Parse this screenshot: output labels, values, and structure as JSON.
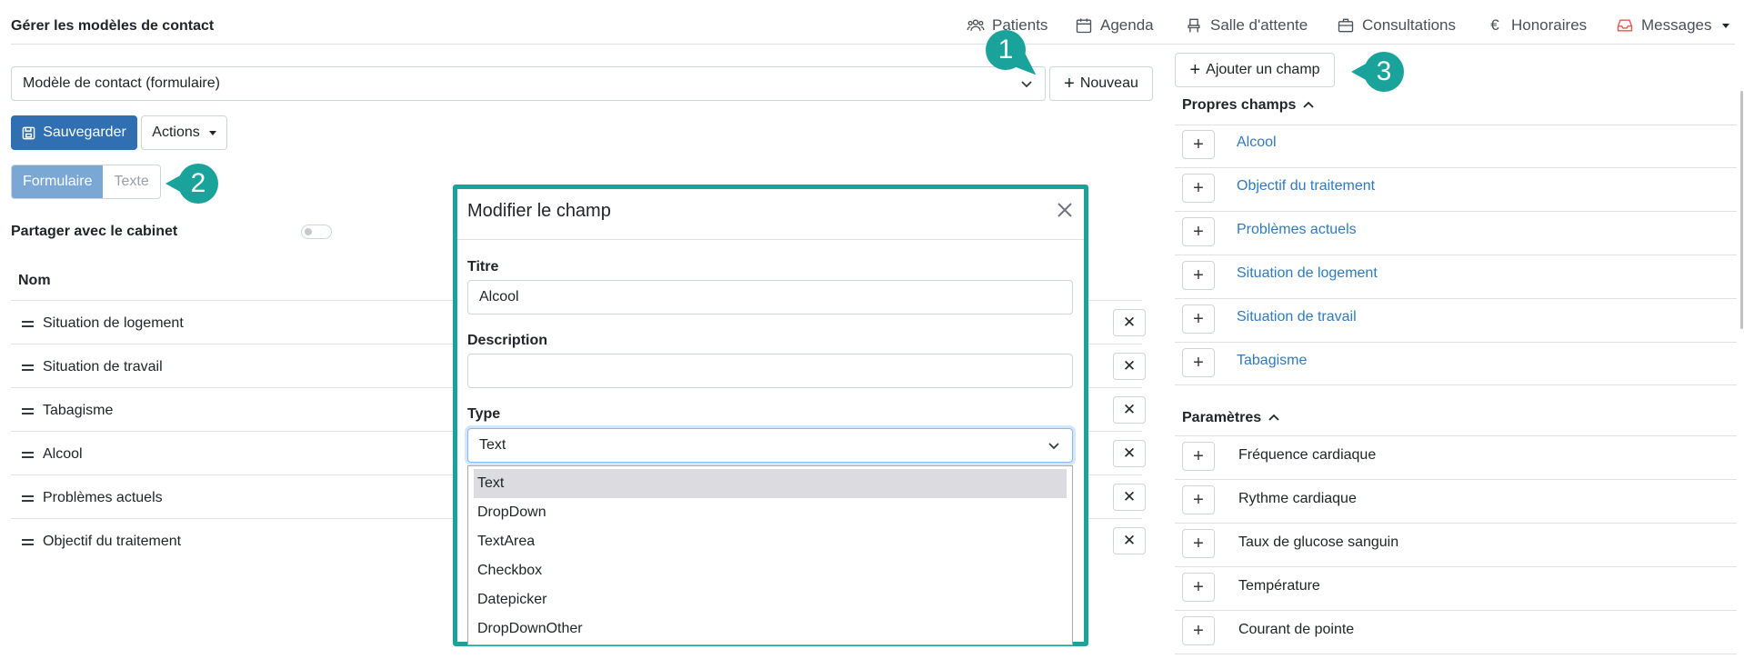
{
  "header": {
    "title": "Gérer les modèles de contact",
    "nav": [
      {
        "label": "Patients",
        "icon": "users-icon"
      },
      {
        "label": "Agenda",
        "icon": "calendar-icon"
      },
      {
        "label": "Salle d'attente",
        "icon": "chair-icon"
      },
      {
        "label": "Consultations",
        "icon": "briefcase-icon"
      },
      {
        "label": "Honoraires",
        "icon": "euro-icon"
      },
      {
        "label": "Messages",
        "icon": "inbox-icon"
      }
    ]
  },
  "template": {
    "selected": "Modèle de contact (formulaire)",
    "new_label": "Nouveau"
  },
  "toolbar": {
    "save_label": "Sauvegarder",
    "actions_label": "Actions"
  },
  "mode_toggle": {
    "form_label": "Formulaire",
    "text_label": "Texte",
    "active": "Formulaire"
  },
  "share": {
    "label": "Partager avec le cabinet",
    "enabled": false
  },
  "fields_table": {
    "column": "Nom",
    "rows": [
      "Situation de logement",
      "Situation de travail",
      "Tabagisme",
      "Alcool",
      "Problèmes actuels",
      "Objectif du traitement"
    ],
    "remove_symbol": "✕"
  },
  "right_panel": {
    "add_field_label": "Ajouter un champ",
    "own_fields": {
      "title": "Propres champs",
      "items": [
        "Alcool",
        "Objectif du traitement",
        "Problèmes actuels",
        "Situation de logement",
        "Situation de travail",
        "Tabagisme"
      ]
    },
    "parameters": {
      "title": "Paramètres",
      "items": [
        "Fréquence cardiaque",
        "Rythme cardiaque",
        "Taux de glucose sanguin",
        "Température",
        "Courant de pointe"
      ]
    }
  },
  "modal": {
    "title": "Modifier le champ",
    "title_label": "Titre",
    "title_value": "Alcool",
    "description_label": "Description",
    "description_value": "",
    "type_label": "Type",
    "type_value": "Text",
    "type_options": [
      "Text",
      "DropDown",
      "TextArea",
      "Checkbox",
      "Datepicker",
      "DropDownOther"
    ],
    "highlighted_option": "Text"
  },
  "callouts": [
    "1",
    "2",
    "3"
  ],
  "colors": {
    "primary": "#2f6fb2",
    "link": "#2f7abf",
    "callout": "#1aa39a",
    "segment_active": "#7ba7d4",
    "messages_icon": "#e05a4f"
  }
}
